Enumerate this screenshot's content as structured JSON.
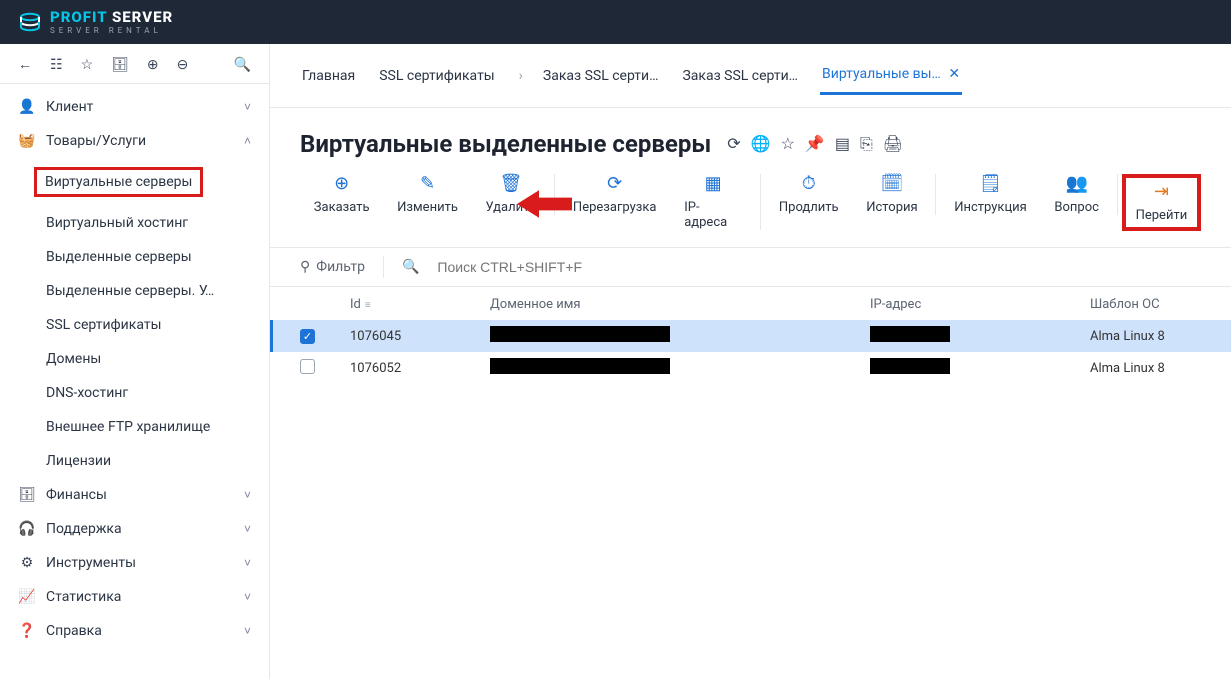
{
  "brand": {
    "name_a": "PROFIT",
    "name_b": "SERVER",
    "tag": "SERVER RENTAL"
  },
  "breadcrumb": {
    "items": [
      {
        "label": "Главная"
      },
      {
        "label": "SSL сертификаты"
      },
      {
        "label": "Заказ SSL серти…",
        "sep": true
      },
      {
        "label": "Заказ SSL серти…"
      },
      {
        "label": "Виртуальные вы…",
        "active": true,
        "close": "✕"
      }
    ]
  },
  "sidebar": {
    "items": [
      {
        "icon": "👤",
        "label": "Клиент",
        "chev": "˅"
      },
      {
        "icon": "🧺",
        "label": "Товары/Услуги",
        "chev": "˄",
        "expanded": true,
        "sub": [
          {
            "label": "Виртуальные серверы",
            "active": true
          },
          {
            "label": "Виртуальный хостинг"
          },
          {
            "label": "Выделенные серверы"
          },
          {
            "label": "Выделенные серверы. У…"
          },
          {
            "label": "SSL сертификаты"
          },
          {
            "label": "Домены"
          },
          {
            "label": "DNS-хостинг"
          },
          {
            "label": "Внешнее FTP хранилище"
          },
          {
            "label": "Лицензии"
          }
        ]
      },
      {
        "icon": "🗄",
        "label": "Финансы",
        "chev": "˅"
      },
      {
        "icon": "🎧",
        "label": "Поддержка",
        "chev": "˅"
      },
      {
        "icon": "⚙",
        "label": "Инструменты",
        "chev": "˅"
      },
      {
        "icon": "📈",
        "label": "Статистика",
        "chev": "˅"
      },
      {
        "icon": "❓",
        "label": "Справка",
        "chev": "˅"
      }
    ]
  },
  "page": {
    "title": "Виртуальные выделенные серверы"
  },
  "actions": [
    {
      "icon": "⊕",
      "label": "Заказать"
    },
    {
      "icon": "✎",
      "label": "Изменить"
    },
    {
      "icon": "🗑",
      "label": "Удалить",
      "sep": true
    },
    {
      "icon": "⟳",
      "label": "Перезагрузка"
    },
    {
      "icon": "▦",
      "label": "IP-адреса",
      "sep": true
    },
    {
      "icon": "⏱",
      "label": "Продлить"
    },
    {
      "icon": "🗓",
      "label": "История",
      "sep": true
    },
    {
      "icon": "🗒",
      "label": "Инструкция"
    },
    {
      "icon": "👥",
      "label": "Вопрос",
      "sep": true
    },
    {
      "icon": "⇥",
      "label": "Перейти",
      "boxed": true,
      "orange": true
    }
  ],
  "filter": {
    "label": "Фильтр",
    "search_placeholder": "Поиск CTRL+SHIFT+F"
  },
  "table": {
    "columns": {
      "id": "Id",
      "domain": "Доменное имя",
      "ip": "IP-адрес",
      "os": "Шаблон ОС"
    },
    "rows": [
      {
        "id": "1076045",
        "os": "Alma Linux 8",
        "selected": true
      },
      {
        "id": "1076052",
        "os": "Alma Linux 8",
        "selected": false
      }
    ]
  }
}
